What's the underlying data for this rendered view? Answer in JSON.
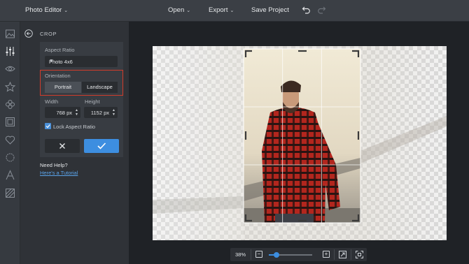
{
  "topbar": {
    "app_menu": "Photo Editor",
    "open": "Open",
    "export": "Export",
    "save": "Save Project"
  },
  "panel": {
    "title": "CROP",
    "aspect_label": "Aspect Ratio",
    "aspect_value": "Photo 4x6",
    "orientation_label": "Orientation",
    "portrait": "Portrait",
    "landscape": "Landscape",
    "width_label": "Width",
    "width_value": "768 px",
    "height_label": "Height",
    "height_value": "1152 px",
    "lock_label": "Lock Aspect Ratio",
    "lock_checked": true,
    "help_title": "Need Help?",
    "tutorial_link": "Here's a Tutorial"
  },
  "zoom": {
    "percent": "38%",
    "level": 0.18
  },
  "colors": {
    "accent": "#3d8ee0",
    "highlight": "#d13c2b"
  },
  "rail_icons": [
    "image-icon",
    "sliders-icon",
    "eye-icon",
    "star-icon",
    "flower-icon",
    "frame-icon",
    "heart-icon",
    "badge-icon",
    "text-icon",
    "texture-icon"
  ]
}
